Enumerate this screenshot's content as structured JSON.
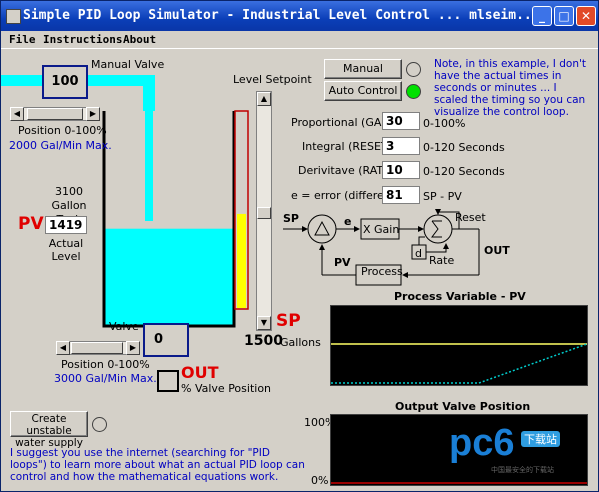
{
  "window": {
    "title": "Simple PID Loop Simulator - Industrial Level Control ... mlseim...",
    "min_icon": "_",
    "max_icon": "□",
    "close_icon": "✕"
  },
  "menu": [
    "File",
    "Instructions",
    "About"
  ],
  "tank": {
    "manual_valve_label": "Manual Valve",
    "inflow_value": "100",
    "position_label": "Position 0-100%",
    "inflow_rate": "2000  Gal/Min Max.",
    "tank_label": "3100 Gallon Tank",
    "pv_label": "PV",
    "pv_value": "1419",
    "actual_level_label": "Actual Level",
    "level_fraction": 0.45
  },
  "setpoint": {
    "label": "Level Setpoint",
    "sp_label": "SP",
    "sp_value": "1500",
    "unit": "Gallons",
    "level_fraction": 0.48
  },
  "outlet": {
    "valve_label": "Valve",
    "valve_value": "0",
    "position_label": "Position 0-100%",
    "rate": "3000 Gal/Min Max.",
    "out_label": "OUT",
    "out_sub": "% Valve Position"
  },
  "controls": {
    "manual_button": "Manual Control",
    "auto_button": "Auto Control",
    "note": "Note, in this example, I don't have the actual times in seconds or minutes ... I scaled the timing so you can visualize the control loop.",
    "proportional_label": "Proportional (GAIN)",
    "proportional_value": "30",
    "proportional_unit": "0-100%",
    "integral_label": "Integral (RESET)",
    "integral_value": "3",
    "integral_unit": "0-120 Seconds",
    "derivative_label": "Derivitave (RATE)",
    "derivative_value": "10",
    "derivative_unit": "0-120 Seconds",
    "error_label": "e = error (difference)",
    "error_value": "81",
    "error_unit": "SP - PV"
  },
  "diagram": {
    "sp": "SP",
    "e": "e",
    "xgain": "X Gain",
    "reset": "Reset",
    "d": "d",
    "rate": "Rate",
    "out": "OUT",
    "pv": "PV",
    "process": "Process"
  },
  "charts": {
    "pv_title": "Process Variable - PV",
    "valve_title": "Output Valve Position",
    "pct100": "100%",
    "pct0": "0%"
  },
  "unstable": {
    "button": "Create unstable water supply"
  },
  "footer_text": "I suggest you use the internet (searching for \"PID loops\") to learn more about what an actual PID loop can control and how the mathematical equations work.",
  "watermark": {
    "brand": "pc6",
    "tag": "下载站",
    "sub": "中国最安全的下载站"
  },
  "colors": {
    "water": "#00ffff",
    "sp_bar": "#ffff00",
    "red": "#e00000",
    "pv_line": "#ffff66",
    "valve_line": "#00cccc"
  }
}
